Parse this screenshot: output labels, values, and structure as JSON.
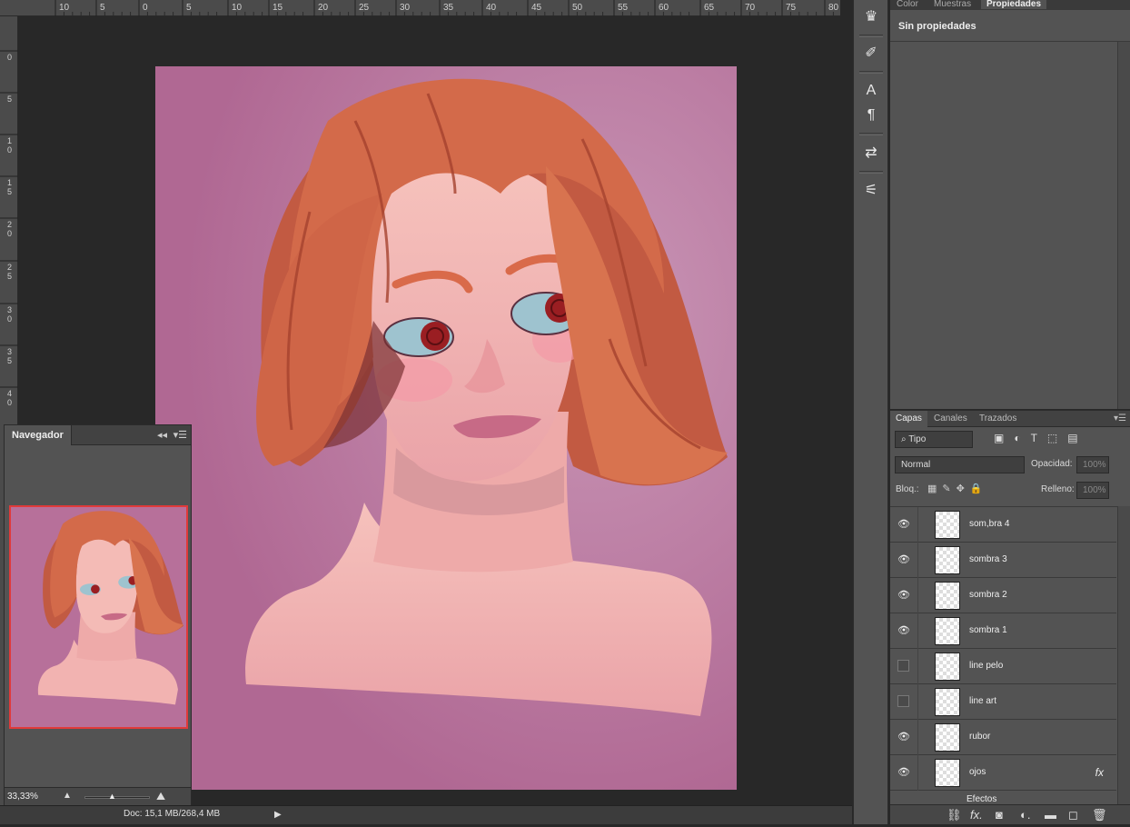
{
  "ruler": {
    "top_labels": [
      "10",
      "5",
      "0",
      "5",
      "10",
      "15",
      "20",
      "25",
      "30",
      "35",
      "40",
      "45",
      "50",
      "55",
      "60",
      "65",
      "70",
      "75",
      "80"
    ],
    "left_labels": [
      "0",
      "5",
      "1\n0",
      "1\n5",
      "2\n0",
      "2\n5",
      "3\n0",
      "3\n5",
      "4\n0"
    ]
  },
  "document": {
    "info": "Doc: 15,1 MB/268,4 MB",
    "arrow": "▶"
  },
  "navigator": {
    "tab": "Navegador",
    "collapse": "◂◂",
    "menu": "▾☰",
    "zoom": "33,33%",
    "small_icon": "▲",
    "knob": "▲",
    "big_icon": "⛰"
  },
  "tools": [
    "♛",
    "✐",
    "A",
    "¶",
    "⇄",
    "⚟"
  ],
  "properties": {
    "tabs": [
      "Color",
      "Muestras",
      "Propiedades"
    ],
    "title": "Sin propiedades"
  },
  "layers_panel": {
    "tabs": [
      "Capas",
      "Canales",
      "Trazados"
    ],
    "filter_label": "⌕ Tipo",
    "blend_mode": "Normal",
    "opacity_label": "Opacidad:",
    "opacity_value": "100%",
    "lock_label": "Bloq.:",
    "fill_label": "Relleno:",
    "fill_value": "100%",
    "layers": [
      {
        "name": "som,bra 4",
        "visible": true,
        "fx": ""
      },
      {
        "name": "sombra 3",
        "visible": true,
        "fx": ""
      },
      {
        "name": "sombra 2",
        "visible": true,
        "fx": ""
      },
      {
        "name": "sombra 1",
        "visible": true,
        "fx": ""
      },
      {
        "name": "line pelo",
        "visible": false,
        "fx": ""
      },
      {
        "name": "line art",
        "visible": false,
        "fx": ""
      },
      {
        "name": "rubor",
        "visible": true,
        "fx": ""
      },
      {
        "name": "ojos",
        "visible": true,
        "fx": "fx"
      }
    ],
    "effects_label": "Efectos",
    "footer_icons": [
      "⛓",
      "fx.",
      "◙",
      "◐.",
      "▬",
      "◻",
      "🗑"
    ]
  },
  "colors": {
    "canvas_bg": "#b7709a",
    "hair": "#d36a4a",
    "skin": "#f2b0b0",
    "eye": "#9ec3cf",
    "iris": "#9a1e22"
  }
}
